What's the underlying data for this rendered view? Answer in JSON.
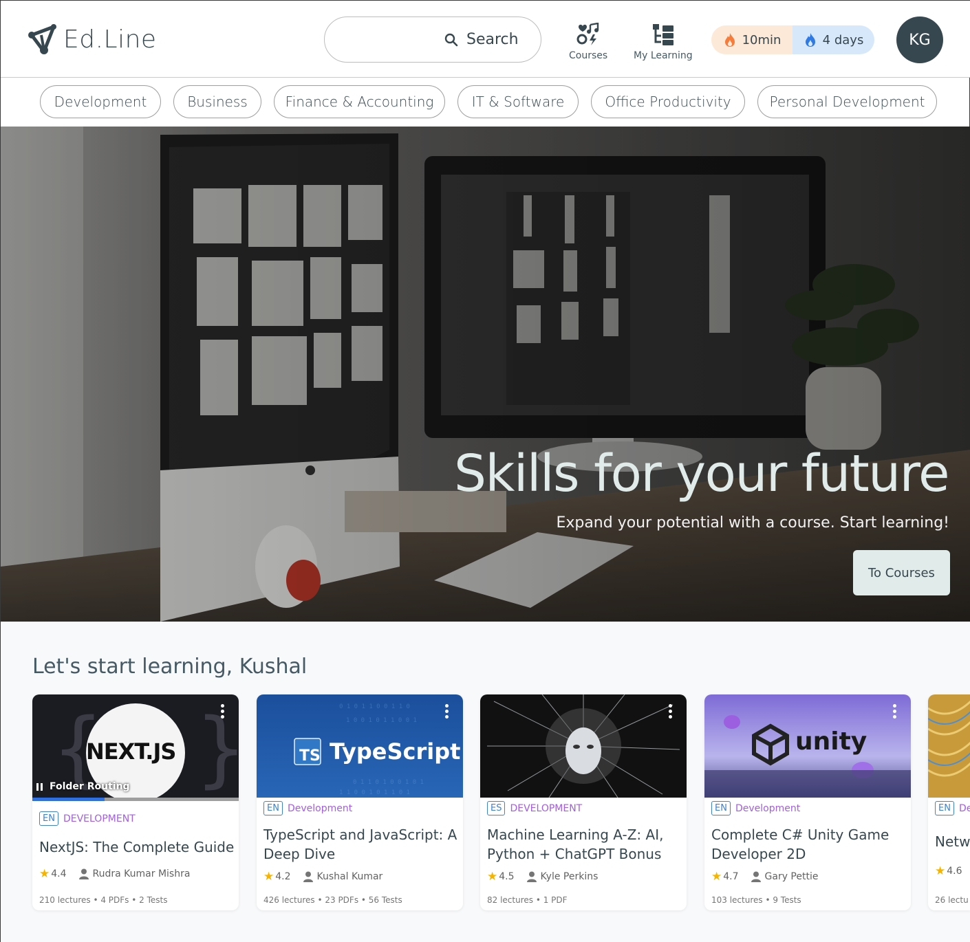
{
  "brand": {
    "name": "Ed.Line"
  },
  "search": {
    "placeholder": "Search"
  },
  "nav": {
    "courses_label": "Courses",
    "my_learning_label": "My Learning"
  },
  "streak": {
    "time": "10min",
    "days": "4 days"
  },
  "user": {
    "initials": "KG"
  },
  "categories": [
    "Development",
    "Business",
    "Finance & Accounting",
    "IT & Software",
    "Office Productivity",
    "Personal Development"
  ],
  "hero": {
    "title": "Skills for your future",
    "subtitle": "Expand your potential with a course. Start learning!",
    "cta": "To Courses"
  },
  "learning": {
    "heading": "Let's start learning, Kushal",
    "courses": [
      {
        "thumb_text": "NEXT.JS",
        "chapter": "Folder Routing",
        "progress": 0.35,
        "lang": "EN",
        "category": "DEVELOPMENT",
        "title": "NextJS: The Complete Guide",
        "rating": "4.4",
        "instructor": "Rudra Kumar Mishra",
        "details": "210 lectures • 4 PDFs • 2 Tests"
      },
      {
        "thumb_text": "TypeScript",
        "lang": "EN",
        "category": "Development",
        "title": "TypeScript and JavaScript: A Deep Dive",
        "rating": "4.2",
        "instructor": "Kushal Kumar",
        "details": "426 lectures • 23 PDFs • 56 Tests"
      },
      {
        "lang": "ES",
        "category": "DEVELOPMENT",
        "title": "Machine Learning A-Z: AI, Python + ChatGPT Bonus",
        "rating": "4.5",
        "instructor": "Kyle Perkins",
        "details": "82 lectures • 1 PDF"
      },
      {
        "thumb_text": "unity",
        "lang": "EN",
        "category": "Development",
        "title": "Complete C# Unity Game Developer 2D",
        "rating": "4.7",
        "instructor": "Gary Pettie",
        "details": "103 lectures • 9 Tests"
      },
      {
        "lang": "EN",
        "category": "De",
        "title": "Netw",
        "rating": "4.6",
        "details": "26 lectu"
      }
    ]
  },
  "colors": {
    "primary": "#37474f",
    "accent_purple": "#a25ee4",
    "lang_blue": "#3f82d4",
    "star": "#f6b400",
    "hero_title": "#e0ebea"
  }
}
